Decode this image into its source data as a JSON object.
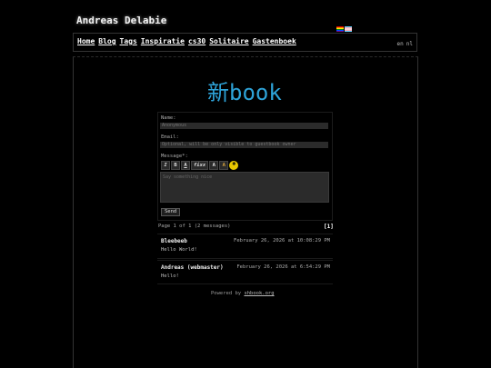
{
  "site": {
    "title": "Andreas Delabie"
  },
  "nav": {
    "items": [
      "Home",
      "Blog",
      "Tags",
      "Inspiratie",
      "cs30",
      "Solitaire",
      "Gastenboek"
    ]
  },
  "lang": {
    "en": "en",
    "nl": "nl"
  },
  "logo": {
    "kanji": "新",
    "text": "book"
  },
  "form": {
    "name_label": "Name:",
    "name_placeholder": "Anonymous",
    "email_label": "Email:",
    "email_placeholder": "Optional, will be only visible to guestbook owner",
    "message_label": "Message*:",
    "message_placeholder": "Say something nice",
    "toolbar": [
      "I",
      "B",
      "A",
      "fixx",
      "A",
      "A"
    ],
    "send_label": "Send"
  },
  "pagination": {
    "summary": "Page 1 of 1 (2 messages)",
    "page_link": "[1]"
  },
  "entries": [
    {
      "name": "Bleebeeb",
      "date": "February 26, 2026 at 10:08:29 PM",
      "message": "Hello World!"
    },
    {
      "name": "Andreas (webmaster)",
      "date": "February 26, 2026 at 6:54:29 PM",
      "message": "Hello!"
    }
  ],
  "footer": {
    "prefix": "Powered by",
    "link": "shbook.org"
  }
}
